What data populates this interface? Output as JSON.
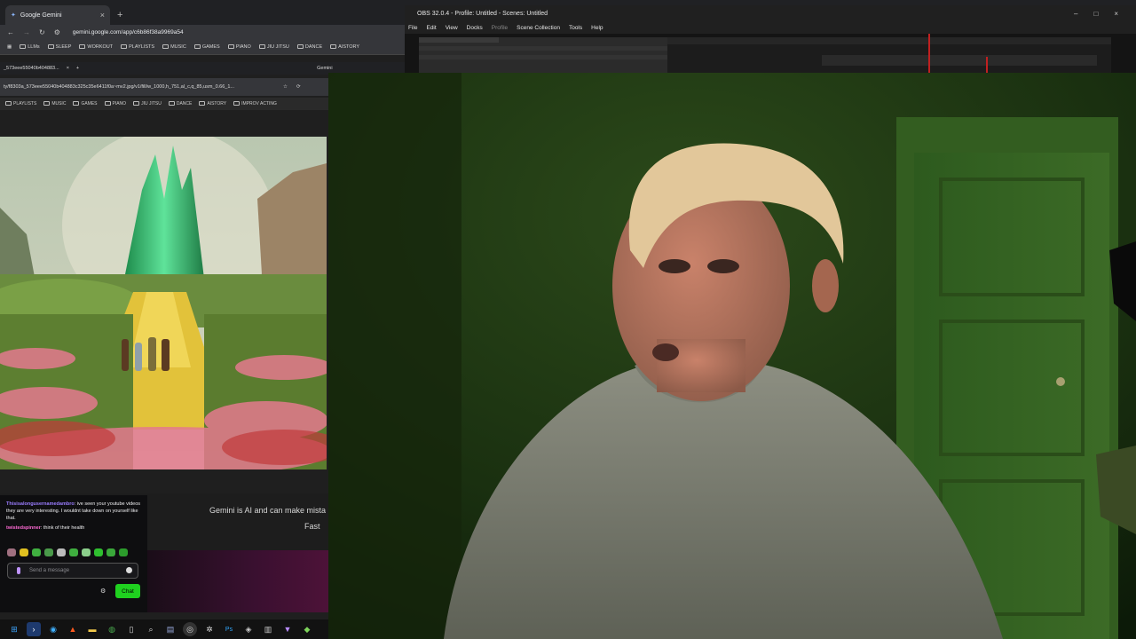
{
  "browser": {
    "tab_title": "Google Gemini",
    "tab_close": "×",
    "new_tab": "+",
    "url": "gemini.google.com/app/c6b86f38a9969a54",
    "bookmarks": [
      "LLMs",
      "SLEEP",
      "WORKOUT",
      "PLAYLISTS",
      "MUSIC",
      "GAMES",
      "PIANO",
      "JIU JITSU",
      "DANCE",
      "AISTORY"
    ]
  },
  "inner_browser": {
    "tab_title": "_573eee55040b404883...",
    "tab_close": "×",
    "new_tab": "+",
    "second_tab": "Gemini",
    "url": "ty/f8303a_573eee55040b404883c325c35e6411f0a~mv2.jpg/v1/fill/w_1000,h_751,al_c,q_85,usm_0.66_1...",
    "bookmarks": [
      "PLAYLISTS",
      "MUSIC",
      "GAMES",
      "PIANO",
      "JIU JITSU",
      "DANCE",
      "AISTORY",
      "IMPROV ACTING"
    ]
  },
  "gemini": {
    "disclaimer": "Gemini is AI and can make mista",
    "model": "Fast"
  },
  "chat": {
    "messages": [
      {
        "user": "Thisisalongusernamedambro",
        "text": ": ive seen your youtube videos they are very interesting. I wouldnt take down on yourself like that."
      },
      {
        "user": "twistedspinner",
        "text": ": think of their health"
      }
    ],
    "input_placeholder": "Send a message",
    "send_button": "Chat"
  },
  "obs": {
    "title": "OBS 32.0.4 - Profile: Untitled - Scenes: Untitled",
    "menu": [
      "File",
      "Edit",
      "View",
      "Docks",
      "Profile",
      "Scene Collection",
      "Tools",
      "Help"
    ],
    "window_controls": [
      "–",
      "□",
      "×"
    ]
  },
  "colors": {
    "chat_button": "#1fd11f",
    "username_1": "#9b7dff",
    "username_2": "#ff6ad5",
    "webcam_tint": "#1e3a14"
  },
  "taskbar_icons": [
    "windows-icon",
    "vscode-icon",
    "edge-icon",
    "brave-icon",
    "explorer-icon",
    "chrome-icon",
    "file-icon",
    "search-icon",
    "calculator-icon",
    "obs-icon",
    "settings-icon",
    "photoshop-icon",
    "app-icon",
    "app2-icon",
    "vpn-icon",
    "android-icon"
  ]
}
